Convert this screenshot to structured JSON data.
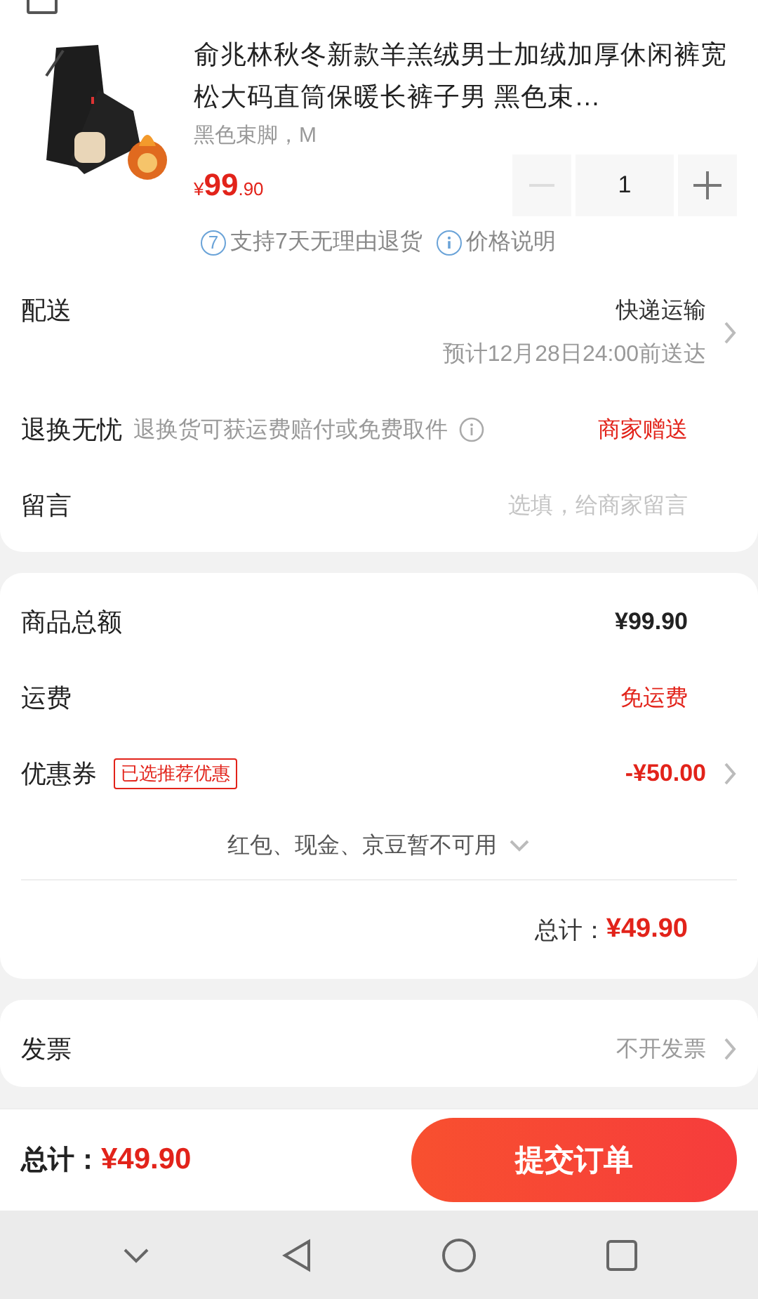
{
  "product": {
    "title": "俞兆林秋冬新款羊羔绒男士加绒加厚休闲裤宽松大码直筒保暖长裤子男 黑色束…",
    "spec": "黑色束脚，M",
    "price_currency": "¥",
    "price_main": "99",
    "price_decimal": ".90",
    "quantity": "1",
    "minus_disabled": true,
    "services": [
      {
        "kind": "seven",
        "badge": "7",
        "text": "支持7天无理由退货"
      },
      {
        "kind": "info",
        "text": "价格说明"
      }
    ]
  },
  "delivery": {
    "label": "配送",
    "method": "快递运输",
    "eta": "预计12月28日24:00前送达"
  },
  "returns": {
    "label": "退换无忧",
    "desc": "退换货可获运费赔付或免费取件",
    "value": "商家赠送"
  },
  "message": {
    "label": "留言",
    "placeholder": "选填，给商家留言"
  },
  "summary": [
    {
      "kind": "plain",
      "label": "商品总额",
      "value": "¥99.90"
    },
    {
      "kind": "red",
      "label": "运费",
      "value": "免运费"
    },
    {
      "kind": "coupon",
      "label": "优惠券",
      "tag": "已选推荐优惠",
      "value": "-¥50.00"
    }
  ],
  "unavailable": "红包、现金、京豆暂不可用",
  "total_label": "总计：",
  "total_value": "¥49.90",
  "invoice": {
    "label": "发票",
    "value": "不开发票"
  },
  "bottom_bar": {
    "total_label": "总计：",
    "total_value": "¥49.90",
    "submit": "提交订单"
  }
}
